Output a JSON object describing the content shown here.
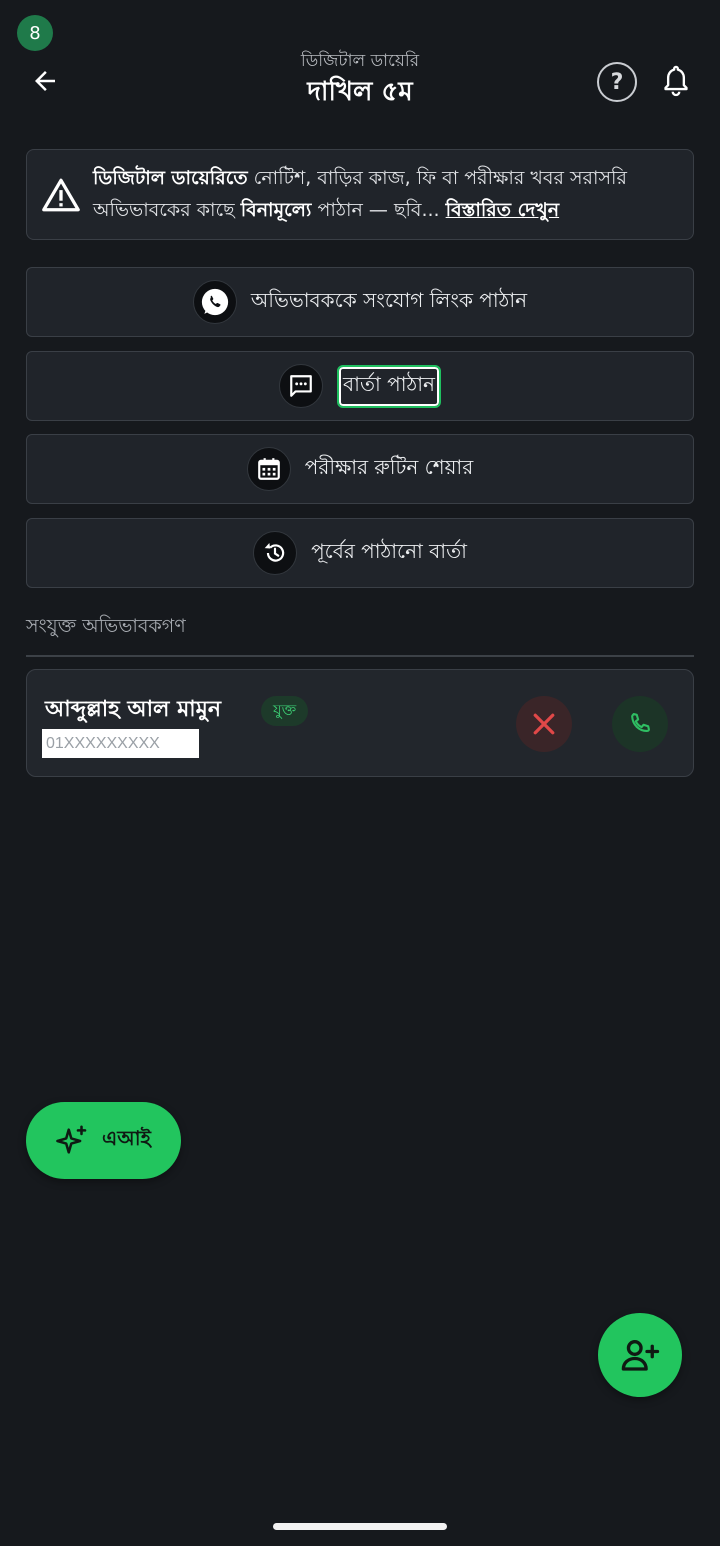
{
  "status": {
    "badge_count": "8"
  },
  "header": {
    "subtitle": "ডিজিটাল ডায়েরি",
    "title": "দাখিল ৫ম",
    "icons": [
      "back-arrow-icon",
      "help-icon",
      "bell-icon"
    ]
  },
  "notice": {
    "icon": "warning-icon",
    "bold_start": "ডিজিটাল ডায়েরিতে",
    "text_a": " নোটিশ, বাড়ির কাজ, ফি বা পরীক্ষার খবর সরাসরি অভিভাবকের কাছে ",
    "bold_mid": "বিনামূল্যে",
    "text_b": " পাঠান — ছবি... ",
    "link": "বিস্তারিত দেখুন"
  },
  "actions": [
    {
      "label": "অভিভাবককে সংযোগ লিংক পাঠান",
      "icon": "whatsapp-icon"
    },
    {
      "label": "বার্তা পাঠান",
      "icon": "message-icon"
    },
    {
      "label": "পরীক্ষার রুটিন শেয়ার",
      "icon": "calendar-icon"
    },
    {
      "label": "পূর্বের পাঠানো বার্তা",
      "icon": "history-icon"
    }
  ],
  "section": {
    "label": "সংযুক্ত অভিভাবকগণ"
  },
  "parent": {
    "name": "আব্দুল্লাহ আল মামুন",
    "status": "যুক্ত",
    "phone": "01XXXXXXXXX"
  },
  "fab": {
    "ai_label": "এআই"
  },
  "colors": {
    "accent": "#22c55e",
    "background": "#16191d",
    "card": "#20242a",
    "danger": "#e04848"
  }
}
